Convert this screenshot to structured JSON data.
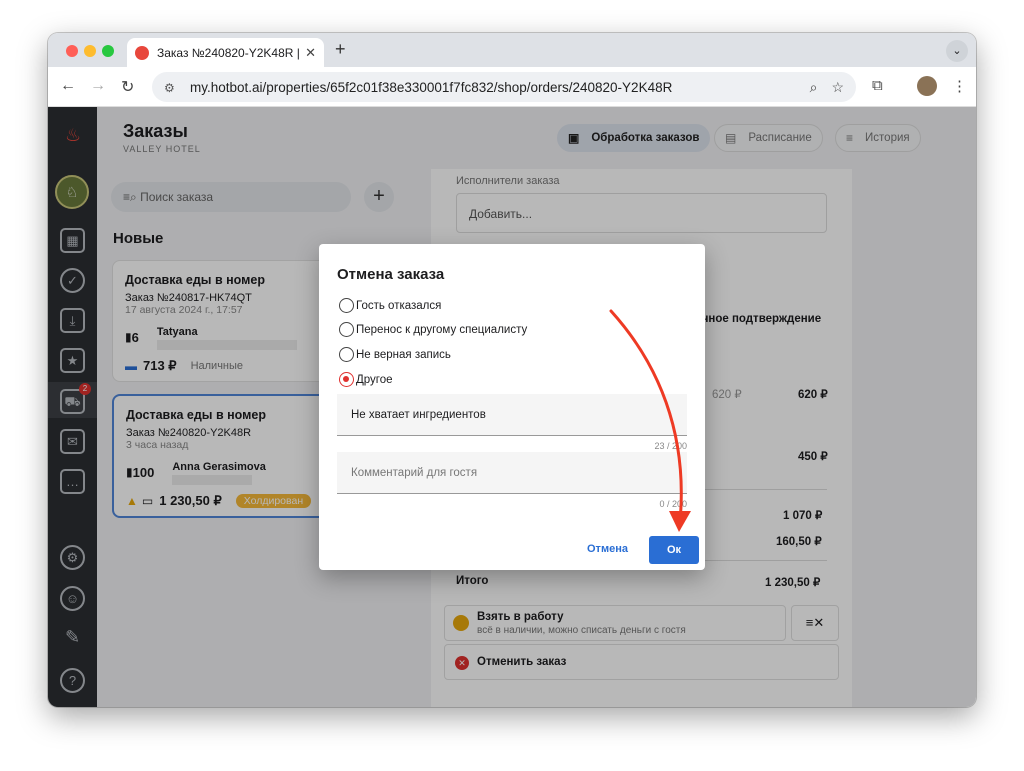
{
  "browser": {
    "tab_title": "Заказ №240820-Y2K48R | V",
    "url": "my.hotbot.ai/properties/65f2c01f38e330001f7fc832/shop/orders/240820-Y2K48R"
  },
  "header": {
    "title": "Заказы",
    "subtitle": "VALLEY HOTEL",
    "segments": [
      "Обработка заказов",
      "Расписание",
      "История"
    ]
  },
  "sidebar": {
    "cart_badge": "2"
  },
  "orders_list": {
    "search_placeholder": "Поиск заказа",
    "section": "Новые",
    "cards": [
      {
        "title": "Доставка еды в номер",
        "number": "Заказ №240817-HK74QT",
        "date": "17 августа 2024 г., 17:57",
        "room": "6",
        "guest": "Tatyana",
        "amount": "713 ₽",
        "payment": "Наличные"
      },
      {
        "title": "Доставка еды в номер",
        "number": "Заказ №240820-Y2K48R",
        "date": "3 часа назад",
        "room": "100",
        "guest": "Anna Gerasimova",
        "amount": "1 230,50 ₽",
        "payment": "Холдирован"
      }
    ]
  },
  "order_detail": {
    "assignees_label": "Исполнители заказа",
    "assignees_placeholder": "Добавить...",
    "confirm_text": "тичное подтверждение",
    "item1_price_gray": "620 ₽",
    "item1_price": "620 ₽",
    "item2_price": "450 ₽",
    "subtotal": "1 070 ₽",
    "extra": "160,50 ₽",
    "total_label": "Итого",
    "total": "1 230,50 ₽",
    "take_label": "Взять в работу",
    "take_sub": "всё в наличии, можно списать деньги с гостя",
    "cancel_label": "Отменить заказ"
  },
  "modal": {
    "title": "Отмена заказа",
    "options": [
      "Гость отказался",
      "Перенос к другому специалисту",
      "Не верная запись",
      "Другое"
    ],
    "selected": "Другое",
    "reason_value": "Не хватает ингредиентов",
    "reason_count": "23 / 200",
    "comment_placeholder": "Комментарий для гостя",
    "comment_count": "0 / 200",
    "cancel": "Отмена",
    "ok": "Ок"
  },
  "colors": {
    "accent": "#2a6ed4",
    "danger": "#e0312f",
    "annotation": "#ee3a24",
    "hold": "#f5b93a"
  }
}
